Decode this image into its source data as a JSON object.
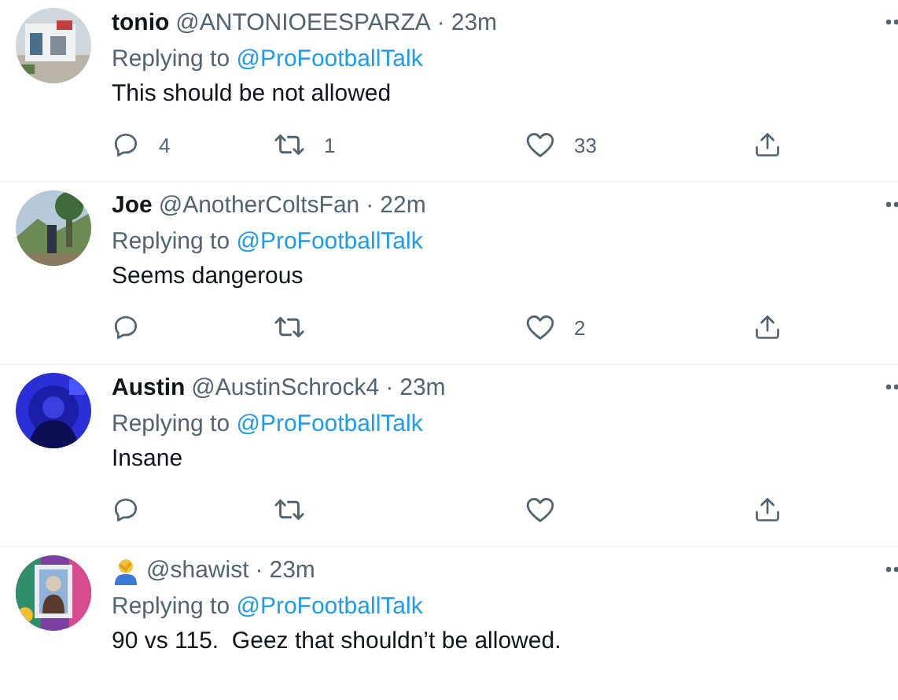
{
  "tweets": [
    {
      "name": "tonio",
      "handle": "@ANTONIOEESPARZA",
      "separator": "·",
      "time": "23m",
      "replying_label": "Replying to",
      "reply_target": "@ProFootballTalk",
      "text": "This should be not allowed",
      "actions": [
        {
          "kind": "reply",
          "count": "4"
        },
        {
          "kind": "retweet",
          "count": "1"
        },
        {
          "kind": "like",
          "count": "33"
        },
        {
          "kind": "share"
        }
      ]
    },
    {
      "name": "Joe",
      "handle": "@AnotherColtsFan",
      "separator": "·",
      "time": "22m",
      "replying_label": "Replying to",
      "reply_target": "@ProFootballTalk",
      "text": "Seems dangerous",
      "actions": [
        {
          "kind": "reply"
        },
        {
          "kind": "retweet"
        },
        {
          "kind": "like",
          "count": "2"
        },
        {
          "kind": "share"
        }
      ]
    },
    {
      "name": "Austin",
      "handle": "@AustinSchrock4",
      "separator": "·",
      "time": "23m",
      "replying_label": "Replying to",
      "reply_target": "@ProFootballTalk",
      "text": "Insane",
      "actions": [
        {
          "kind": "reply"
        },
        {
          "kind": "retweet"
        },
        {
          "kind": "like"
        },
        {
          "kind": "share"
        }
      ]
    },
    {
      "handle": "@shawist",
      "separator": "·",
      "time": "23m",
      "replying_label": "Replying to",
      "reply_target": "@ProFootballTalk",
      "text": "90 vs 115.  Geez that shouldn’t be allowed."
    }
  ]
}
